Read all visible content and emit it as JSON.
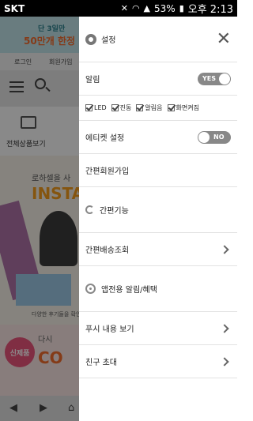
{
  "statusbar": {
    "carrier": "SKT",
    "battery": "53%",
    "time": "오후 2:13"
  },
  "background": {
    "banner_line1": "단 3일만",
    "banner_line2": "50만개 한정",
    "nav_login": "로그인",
    "nav_join": "회원가입",
    "category_label": "전체상품보기",
    "promo_line1": "로하셀을 사",
    "promo_line2": "INSTA",
    "promo_small": "다양한 후기들을 확인",
    "badge": "신제품",
    "promo2_line1": "다시",
    "promo2_line2": "CO"
  },
  "drawer": {
    "title": "설정",
    "notifications": {
      "label": "알림",
      "toggle": "YES"
    },
    "options": [
      "LED",
      "진동",
      "알림음",
      "화면켜짐"
    ],
    "etiquette": {
      "label": "에티켓 설정",
      "toggle": "NO"
    },
    "simple_join": "간편회원가입",
    "simple_function": "간편기능",
    "delivery": "간편배송조회",
    "app_notice": "앱전용 알림/혜택",
    "push": "푸시 내용 보기",
    "invite": "친구 초대"
  }
}
